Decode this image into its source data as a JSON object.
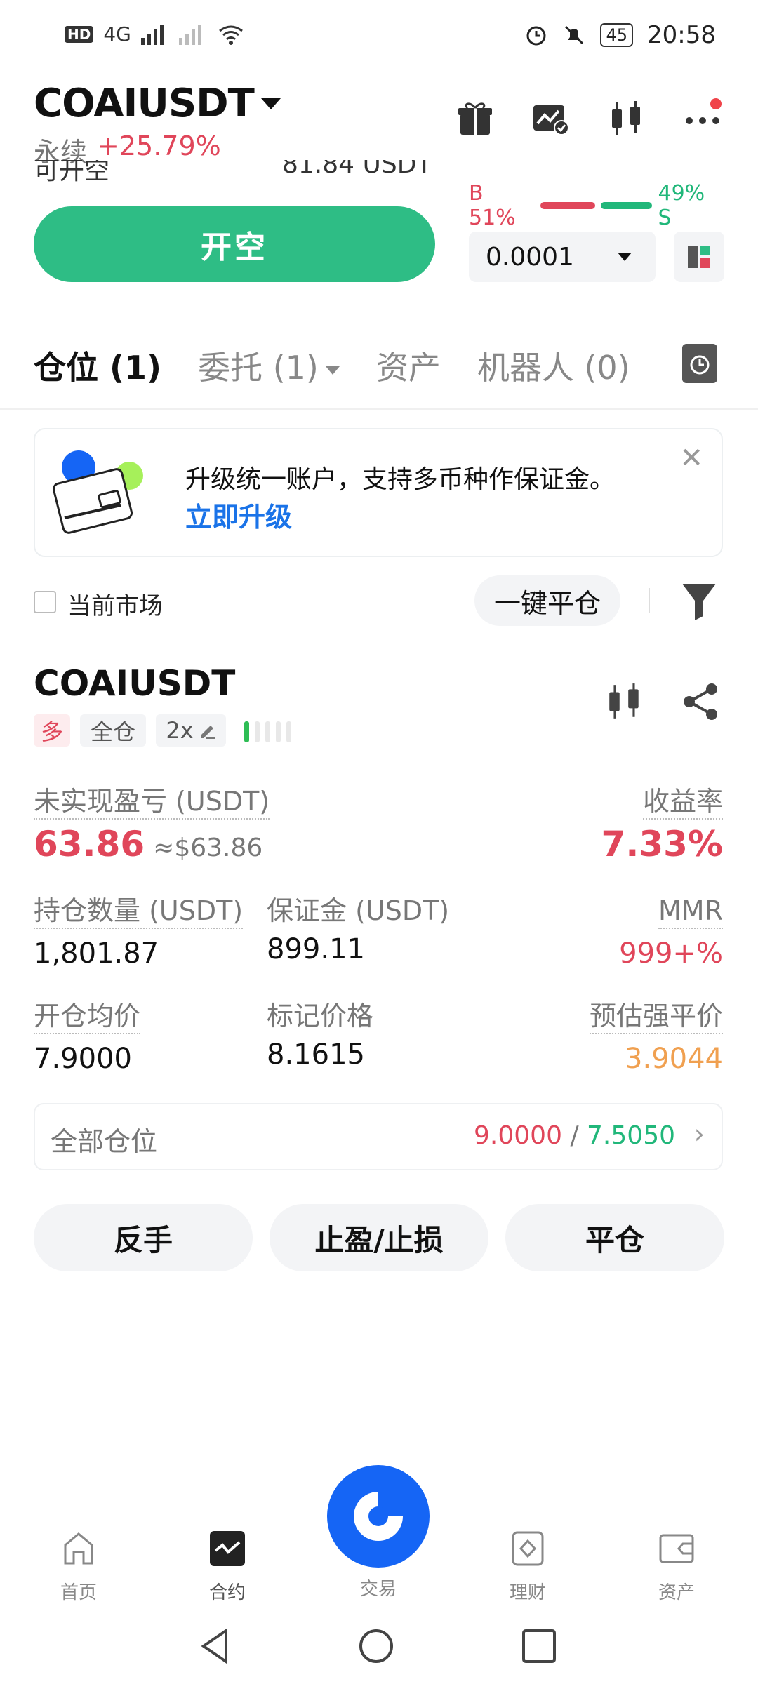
{
  "status_bar": {
    "network": "4G",
    "battery": "45",
    "time": "20:58"
  },
  "header": {
    "pair": "COAIUSDT",
    "type": "永续",
    "change": "+25.79%"
  },
  "order_panel": {
    "available_label": "可开空",
    "available_value": "81.84 USDT",
    "buy_ratio": "B 51%",
    "sell_ratio": "49% S",
    "open_short_label": "开空",
    "quantity_step": "0.0001"
  },
  "tabs": [
    {
      "label": "仓位 (1)"
    },
    {
      "label": "委托 (1)"
    },
    {
      "label": "资产"
    },
    {
      "label": "机器人 (0)"
    }
  ],
  "banner": {
    "title": "升级统一账户，支持多币种作保证金。",
    "link": "立即升级"
  },
  "filter_row": {
    "current_market_label": "当前市场",
    "close_all_label": "一键平仓"
  },
  "position": {
    "pair": "COAIUSDT",
    "side": "多",
    "margin_mode": "全仓",
    "leverage": "2x",
    "unrealized_pnl_label": "未实现盈亏 (USDT)",
    "unrealized_pnl": "63.86",
    "unrealized_pnl_usd": "≈$63.86",
    "roe_label": "收益率",
    "roe": "7.33%",
    "size_label": "持仓数量 (USDT)",
    "size": "1,801.87",
    "margin_label": "保证金 (USDT)",
    "margin": "899.11",
    "mmr_label": "MMR",
    "mmr": "999+%",
    "entry_price_label": "开仓均价",
    "entry_price": "7.9000",
    "mark_price_label": "标记价格",
    "mark_price": "8.1615",
    "liq_price_label": "预估强平价",
    "liq_price": "3.9044",
    "all_positions_label": "全部仓位",
    "all_positions_red": "9.0000",
    "all_positions_sep": "/",
    "all_positions_green": "7.5050"
  },
  "actions": {
    "reverse": "反手",
    "tpsl": "止盈/止损",
    "close": "平仓"
  },
  "bottom_nav": [
    {
      "label": "首页",
      "icon": "home-icon"
    },
    {
      "label": "合约",
      "icon": "futures-icon"
    },
    {
      "label": "交易",
      "icon": "trade-icon"
    },
    {
      "label": "理财",
      "icon": "earn-icon"
    },
    {
      "label": "资产",
      "icon": "wallet-icon"
    }
  ],
  "colors": {
    "buy_green": "#2ebd85",
    "sell_red": "#e0465a",
    "accent_blue": "#1565f5",
    "liq_orange": "#f0a050"
  }
}
